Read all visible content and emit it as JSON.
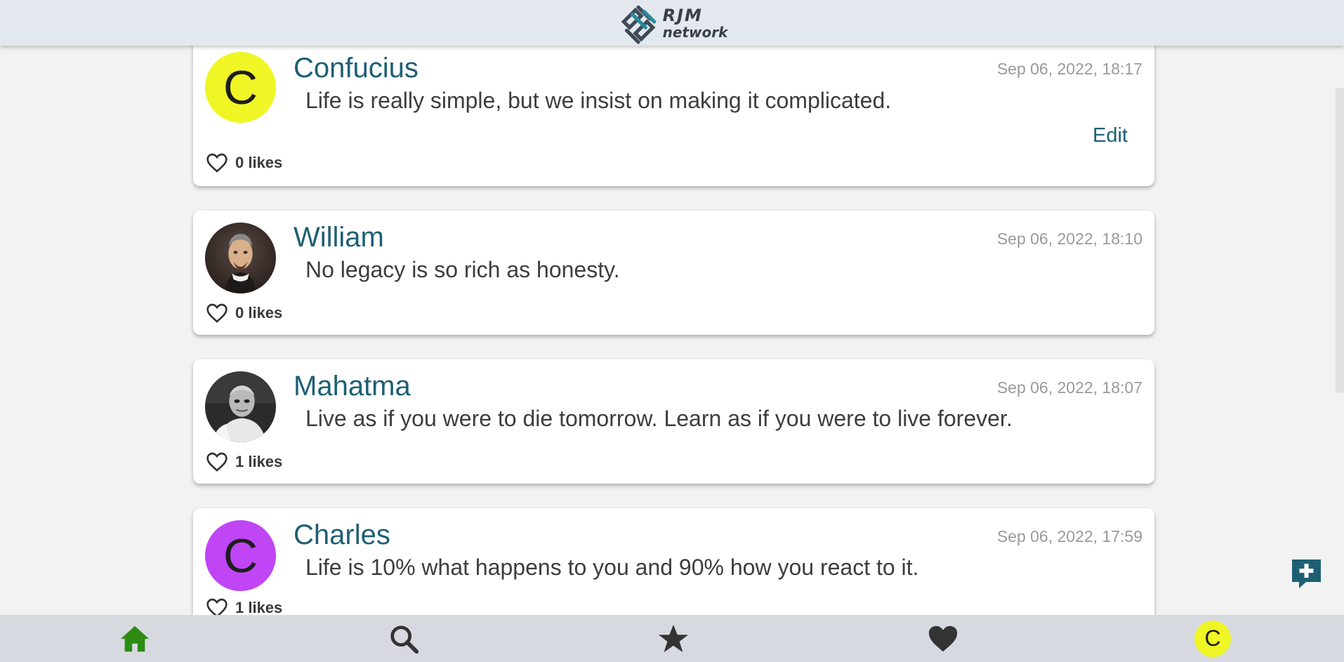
{
  "app": {
    "logo_line1": "RJM",
    "logo_line2": "network"
  },
  "colors": {
    "accent": "#1e5f74",
    "home_active": "#2e8b12",
    "header_bg": "#e3e8ef",
    "nav_bg": "#d6dae0",
    "avatar_yellow": "#f0f525",
    "avatar_purple": "#bf45f5"
  },
  "posts": [
    {
      "author": "Confucius",
      "avatar_type": "initial",
      "avatar_initial": "C",
      "avatar_color": "#f0f525",
      "timestamp": "Sep 06, 2022, 18:17",
      "content": "Life is really simple, but we insist on making it complicated.",
      "likes": "0 likes",
      "edit_label": "Edit"
    },
    {
      "author": "William",
      "avatar_type": "photo",
      "avatar_icon": "portrait-photo",
      "timestamp": "Sep 06, 2022, 18:10",
      "content": "No legacy is so rich as honesty.",
      "likes": "0 likes"
    },
    {
      "author": "Mahatma",
      "avatar_type": "photo",
      "avatar_icon": "portrait-photo-bw",
      "timestamp": "Sep 06, 2022, 18:07",
      "content": "Live as if you were to die tomorrow. Learn as if you were to live forever.",
      "likes": "1 likes"
    },
    {
      "author": "Charles",
      "avatar_type": "initial",
      "avatar_initial": "C",
      "avatar_color": "#bf45f5",
      "timestamp": "Sep 06, 2022, 17:59",
      "content": "Life is 10% what happens to you and 90% how you react to it.",
      "likes": "1 likes"
    }
  ],
  "fab": {
    "icon": "add-comment-icon"
  },
  "bottom_nav": {
    "items": [
      {
        "icon": "home-icon"
      },
      {
        "icon": "search-icon"
      },
      {
        "icon": "star-icon"
      },
      {
        "icon": "heart-icon"
      },
      {
        "icon": "profile-avatar",
        "initial": "C"
      }
    ]
  }
}
